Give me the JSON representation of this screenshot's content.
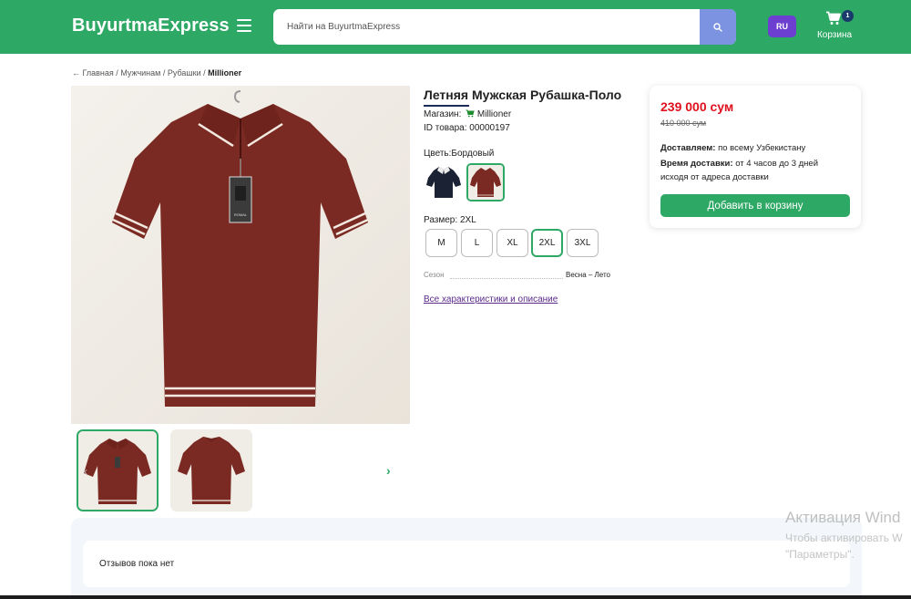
{
  "header": {
    "logo": "BuyurtmaExpress",
    "search_placeholder": "Найти на BuyurtmaExpress",
    "lang": "RU",
    "cart_count": "1",
    "cart_label": "Корзина",
    "brand_color": "#2ea865"
  },
  "breadcrumb": {
    "home": "Главная",
    "sep": "/",
    "cat1": "Мужчинам",
    "cat2": "Рубашки",
    "current": "Millioner"
  },
  "product": {
    "title": "Летняя Мужская Рубашка-Поло",
    "shop_label": "Магазин:",
    "shop_name": "Millioner",
    "id_label": "ID товара:",
    "id_value": "00000197",
    "color_label": "Цветь:",
    "color_value": "Бордовый",
    "colors": [
      {
        "name": "navy",
        "hex": "#1b2233",
        "selected": false
      },
      {
        "name": "burgundy",
        "hex": "#7a2a22",
        "selected": true
      }
    ],
    "size_label": "Размер:",
    "size_value": "2XL",
    "sizes": [
      "M",
      "L",
      "XL",
      "2XL",
      "3XL"
    ],
    "selected_size": "2XL",
    "spec_name": "Сезон",
    "spec_value": "Весна – Лето",
    "all_link": "Все характеристики и описание",
    "shirt_color": "#7a2a22",
    "tag_text": "ROMAL"
  },
  "price_card": {
    "price": "239 000 сум",
    "old_price": "410 000 сум",
    "delivery_label": "Доставляем:",
    "delivery_value": "по всему Узбекистану",
    "time_label": "Время доставки:",
    "time_value": "от 4 часов до 3 дней исходя от адреса доставки",
    "button": "Добавить в корзину",
    "price_color": "#e0101e"
  },
  "reviews": {
    "empty_text": "Отзывов пока нет"
  },
  "watermark": {
    "line1": "Активация Wind",
    "line2": "Чтобы активировать W",
    "line3": "\"Параметры\"."
  }
}
